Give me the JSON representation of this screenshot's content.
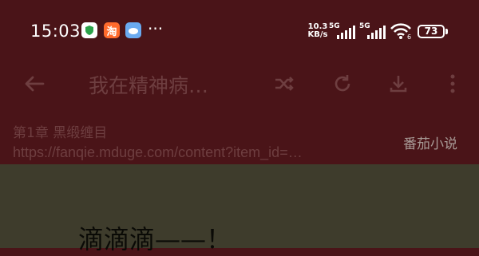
{
  "status_bar": {
    "time": "15:03",
    "notification_icons": [
      "shield-app-icon",
      "taobao-app-icon",
      "weather-app-icon"
    ],
    "taobao_glyph": "淘",
    "more": "···",
    "net_speed_value": "10.3",
    "net_speed_unit": "KB/s",
    "sim1_label": "5G",
    "sim2_label": "5G",
    "battery": "73"
  },
  "toolbar": {
    "title": "我在精神病…",
    "icons": [
      "back-arrow-icon",
      "shuffle-icon",
      "refresh-icon",
      "download-icon",
      "more-vert-icon"
    ]
  },
  "chapter": {
    "name": "第1章 黑缎缠目",
    "url": "https://fanqie.mduge.com/content?item_id=…",
    "source": "番茄小说"
  },
  "content": {
    "text": "滴滴滴——！"
  },
  "colors": {
    "overlay_bg": "#4a1418",
    "content_bg": "#3e3c2c",
    "dim_text": "#6e3e40"
  }
}
